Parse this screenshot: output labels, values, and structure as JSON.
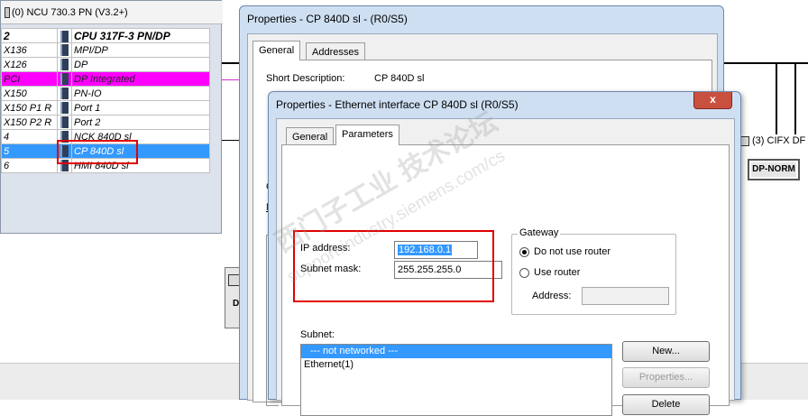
{
  "rack": {
    "title": "(0) NCU 730.3 PN (V3.2+)",
    "rows": [
      {
        "slot": "2",
        "name": "CPU 317F-3 PN/DP",
        "style": "header"
      },
      {
        "slot": "X136",
        "name": "MPI/DP",
        "style": ""
      },
      {
        "slot": "X126",
        "name": "DP",
        "style": ""
      },
      {
        "slot": "PCI",
        "name": "DP Integrated",
        "style": "pink"
      },
      {
        "slot": "X150",
        "name": "PN-IO",
        "style": ""
      },
      {
        "slot": "X150 P1 R",
        "name": "Port 1",
        "style": ""
      },
      {
        "slot": "X150 P2 R",
        "name": "Port 2",
        "style": ""
      },
      {
        "slot": "4",
        "name": "NCK 840D sl",
        "style": ""
      },
      {
        "slot": "5",
        "name": "CP 840D sl",
        "style": "sel"
      },
      {
        "slot": "6",
        "name": "HMI 840D sl",
        "style": ""
      }
    ]
  },
  "left_node": {
    "label": "D"
  },
  "cifx": {
    "label": "(3) CIFX DF",
    "button": "DP-NORM"
  },
  "dialog1": {
    "title": "Properties - CP 840D sl - (R0/S5)",
    "tabs": [
      "General",
      "Addresses"
    ],
    "short_description_label": "Short Description:",
    "short_description_value": "CP 840D sl",
    "fragment_o": "O",
    "fragment_n": "N"
  },
  "dialog2": {
    "title": "Properties - Ethernet interface  CP 840D sl (R0/S5)",
    "close": "x",
    "tabs": [
      "General",
      "Parameters"
    ],
    "ip_label": "IP address:",
    "ip_value": "192.168.0.1",
    "mask_label": "Subnet mask:",
    "mask_value": "255.255.255.0",
    "gateway": {
      "legend": "Gateway",
      "option_no_router": "Do not use router",
      "option_use_router": "Use router",
      "address_label": "Address:",
      "selected": "Do not use router"
    },
    "subnet_label": "Subnet:",
    "subnet_items": [
      "--- not networked ---",
      "Ethernet(1)"
    ],
    "buttons": {
      "new": "New...",
      "properties": "Properties...",
      "delete": "Delete"
    }
  },
  "watermark": {
    "line1": "西门子工业  技术论坛",
    "line2": "support.industry.siemens.com/cs"
  },
  "colors": {
    "selection": "#3399ff",
    "highlight_pink": "#ff00ff",
    "annotation_red": "#e00000",
    "close_red": "#c9503f"
  }
}
